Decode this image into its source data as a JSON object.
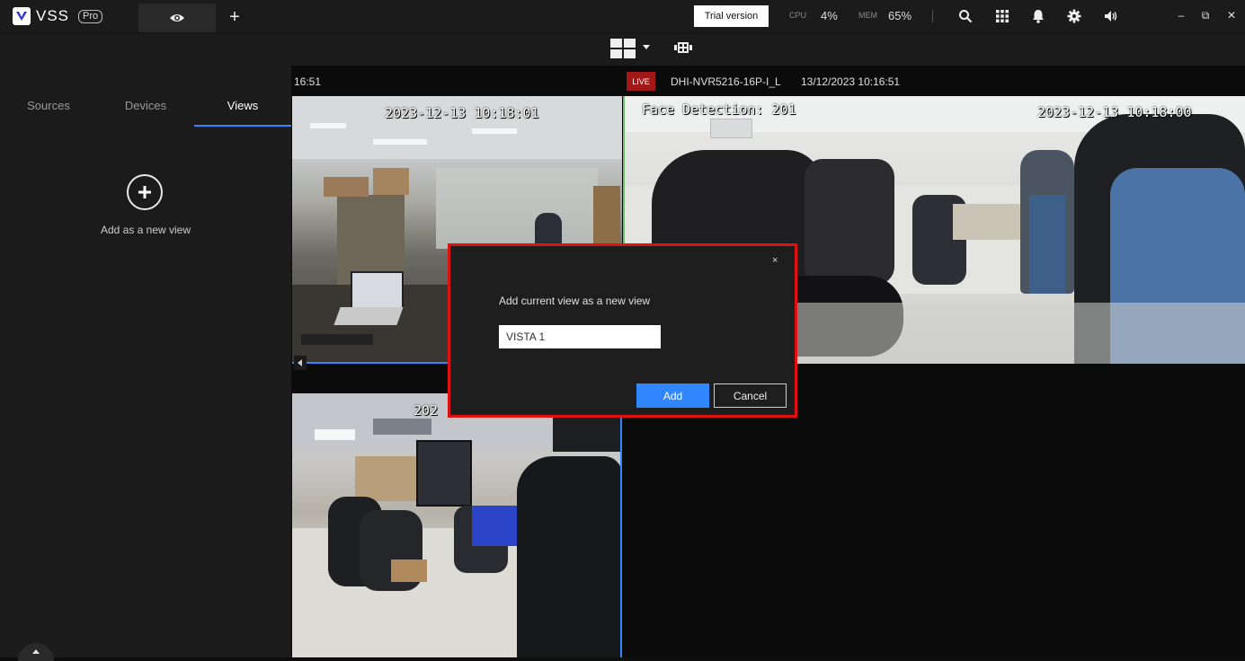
{
  "app": {
    "logo_text": "VSS",
    "edition_badge": "Pro"
  },
  "topbar": {
    "tabs": [
      {
        "icon": "eye-icon"
      },
      {
        "icon": "plus-icon",
        "label": "+"
      }
    ],
    "trial_button": "Trial version",
    "cpu_label": "CPU",
    "cpu_value": "4%",
    "mem_label": "MEM",
    "mem_value": "65%",
    "icons": [
      "search-icon",
      "grid-apps-icon",
      "bell-icon",
      "gear-icon",
      "volume-icon"
    ],
    "window_controls": {
      "minimize": "–",
      "restore": "⧉",
      "close": "✕"
    }
  },
  "sidebar": {
    "tabs": [
      {
        "label": "Sources",
        "active": false
      },
      {
        "label": "Devices",
        "active": false
      },
      {
        "label": "Views",
        "active": true
      }
    ],
    "add_view_label": "Add as a new view"
  },
  "cameras": [
    {
      "time_header": "16:51",
      "osd_timestamp": "2023-12-13 10:18:01"
    },
    {
      "live_badge": "LIVE",
      "device_name": "DHI-NVR5216-16P-I_L",
      "datetime": "13/12/2023 10:16:51",
      "osd_label": "Face Detection: 201",
      "osd_timestamp": "2023-12-13 10:18:00"
    },
    {
      "osd_timestamp_partial": "202"
    }
  ],
  "dialog": {
    "close": "×",
    "title": "Add current view as a new view",
    "input_value": "VISTA 1",
    "add_button": "Add",
    "cancel_button": "Cancel"
  },
  "colors": {
    "accent": "#2f86ff",
    "live_red": "#a01818",
    "highlight_outline": "#e01010",
    "panel": "#1b1b1b"
  }
}
